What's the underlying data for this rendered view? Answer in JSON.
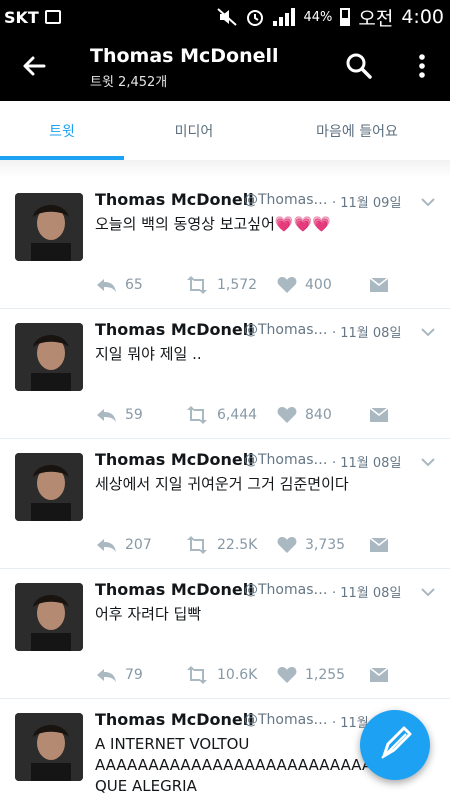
{
  "status": {
    "carrier": "SKT",
    "battery": "44%",
    "period": "오전",
    "time": "4:00"
  },
  "header": {
    "title": "Thomas McDonell",
    "subtitle": "트윗 2,452개"
  },
  "tabs": [
    {
      "label": "트윗",
      "active": true
    },
    {
      "label": "미디어",
      "active": false
    },
    {
      "label": "마음에 들어요",
      "active": false
    }
  ],
  "tweets": [
    {
      "name": "Thomas McDonell",
      "handle": "@Thomas…",
      "date": "· 11월 09일",
      "text": "오늘의 백의 동영상 보고싶어",
      "emoji": "💗💗💗",
      "replies": "65",
      "retweets": "1,572",
      "likes": "400"
    },
    {
      "name": "Thomas McDonell",
      "handle": "@Thomas…",
      "date": "· 11월 08일",
      "text": "지일 뭐야 제일 ..",
      "replies": "59",
      "retweets": "6,444",
      "likes": "840"
    },
    {
      "name": "Thomas McDonell",
      "handle": "@Thomas…",
      "date": "· 11월 08일",
      "text": "세상에서 지일 귀여운거 그거 김준면이다",
      "replies": "207",
      "retweets": "22.5K",
      "likes": "3,735"
    },
    {
      "name": "Thomas McDonell",
      "handle": "@Thomas…",
      "date": "· 11월 08일",
      "text": "어후 자려다 딥빡",
      "replies": "79",
      "retweets": "10.6K",
      "likes": "1,255"
    },
    {
      "name": "Thomas McDonell",
      "handle": "@Thomas…",
      "date": "· 11월",
      "text_lines": [
        "A INTERNET VOLTOU",
        "AAAAAAAAAAAAAAAAAAAAAAAAAAA",
        "QUE ALEGRIA"
      ]
    }
  ],
  "colors": {
    "accent": "#1da1f2",
    "bar": "#000000",
    "emoji_heart": "#ff3aa3"
  },
  "icons": [
    "back-arrow-icon",
    "search-icon",
    "more-vert-icon",
    "reply-icon",
    "retweet-icon",
    "like-icon",
    "dm-icon",
    "compose-icon",
    "chevron-down-icon"
  ]
}
